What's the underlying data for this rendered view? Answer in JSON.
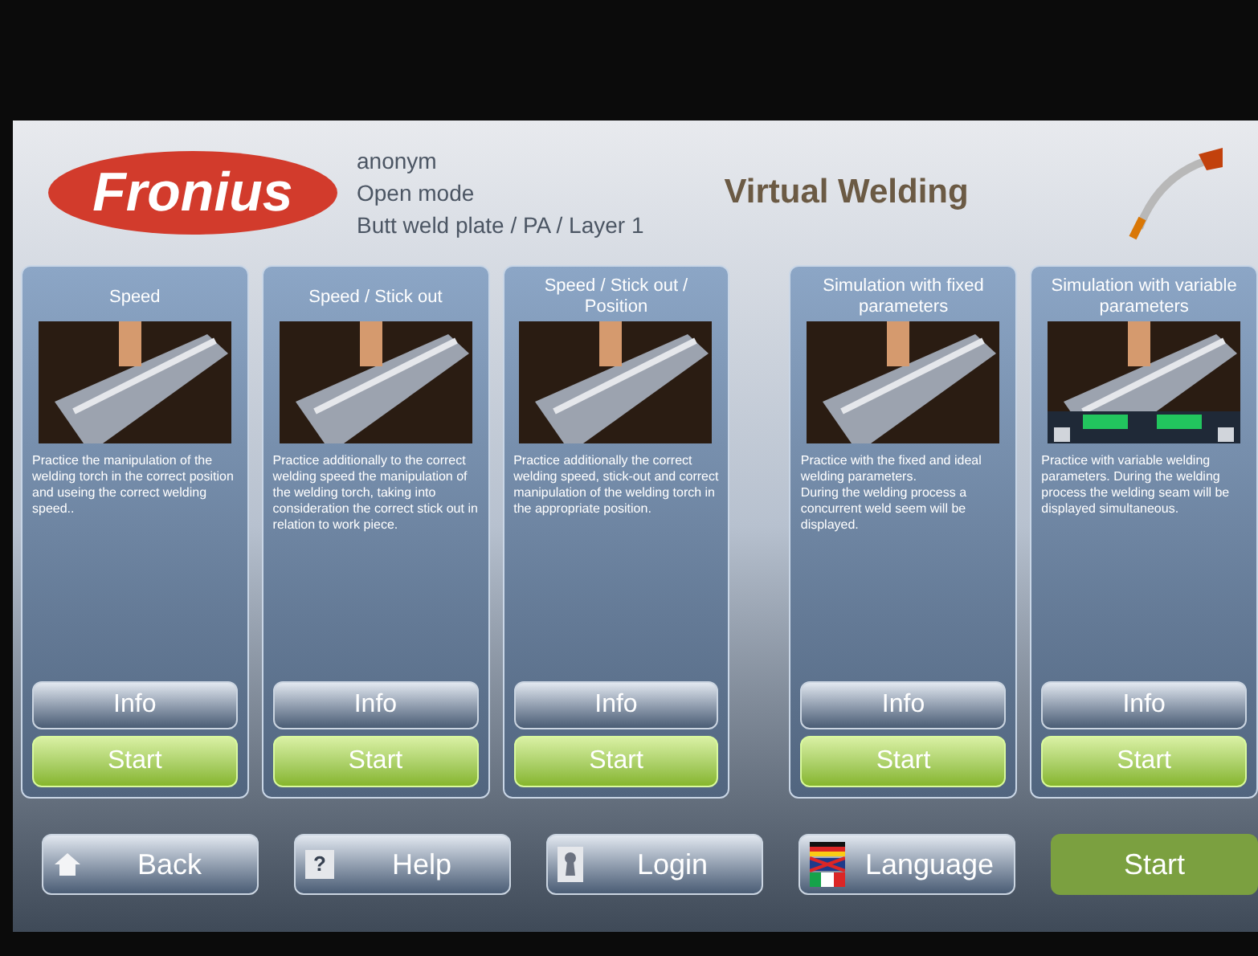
{
  "header": {
    "logo": "Fronius",
    "user": "anonym",
    "mode": "Open mode",
    "job": "Butt weld plate / PA / Layer 1",
    "title": "Virtual Welding"
  },
  "modules": [
    {
      "title": "Speed",
      "description": "Practice the manipulation of the welding torch in the correct position and useing the correct welding speed..",
      "kind": "plate",
      "info": "Info",
      "start": "Start"
    },
    {
      "title": "Speed / Stick out",
      "description": "Practice additionally to the correct welding speed the manipulation of the welding torch, taking into consideration the correct stick out in relation to work piece.",
      "kind": "plate",
      "info": "Info",
      "start": "Start"
    },
    {
      "title": "Speed / Stick out / Position",
      "description": "Practice additionally the correct welding speed, stick-out and correct manipulation of the welding torch in the appropriate position.",
      "kind": "plate",
      "info": "Info",
      "start": "Start"
    },
    {
      "title": "Simulation with fixed parameters",
      "description": "Practice with the fixed and ideal welding parameters.\nDuring the welding process a concurrent weld seem will be displayed.",
      "kind": "plate",
      "info": "Info",
      "start": "Start"
    },
    {
      "title": "Simulation with variable parameters",
      "description": "Practice with variable welding parameters. During the welding process the welding seam will be displayed simultaneous.",
      "kind": "panel",
      "info": "Info",
      "start": "Start"
    }
  ],
  "nav": [
    {
      "kind": "home",
      "label": "Back"
    },
    {
      "kind": "help",
      "icon_text": "?",
      "label": "Help"
    },
    {
      "kind": "key",
      "label": "Login"
    },
    {
      "kind": "flags",
      "label": "Language"
    }
  ],
  "start_button": {
    "label": "Start",
    "disabled": true
  }
}
